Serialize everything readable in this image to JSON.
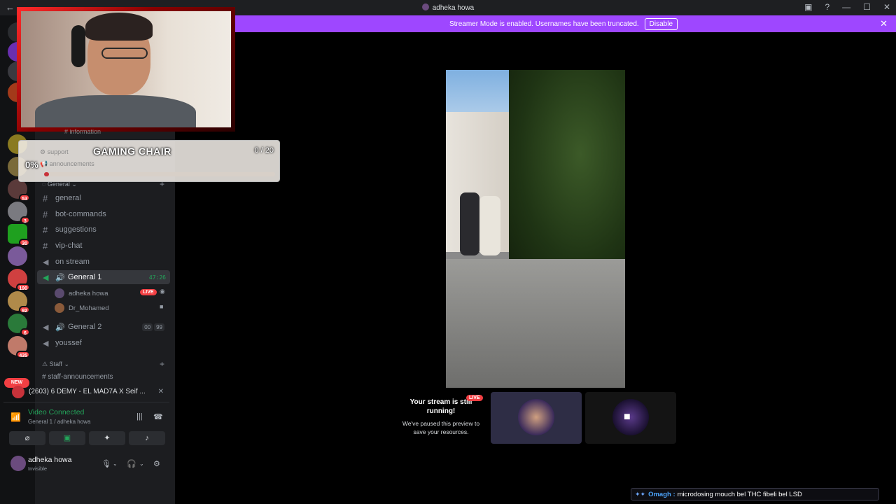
{
  "titlebar": {
    "title": "adheka howa"
  },
  "banner": {
    "text": "Streamer Mode is enabled. Usernames have been truncated.",
    "button": "Disable"
  },
  "guild_badges": [
    "53",
    "3",
    "30",
    "190",
    "92",
    "6",
    "435"
  ],
  "new_label": "NEW",
  "channels": {
    "ghost": [
      "information",
      "support",
      "announcements"
    ],
    "category_general": "General",
    "items": [
      {
        "label": "general",
        "type": "text"
      },
      {
        "label": "bot-commands",
        "type": "text"
      },
      {
        "label": "suggestions",
        "type": "text"
      },
      {
        "label": "vip-chat",
        "type": "text"
      },
      {
        "label": "on stream",
        "type": "announce"
      }
    ],
    "voice_active": {
      "label": "General 1",
      "timer": "47:26"
    },
    "voice_users": [
      {
        "name": "adheka howa",
        "live": "LIVE"
      },
      {
        "name": "Dr_Mohamed"
      }
    ],
    "voice_2": {
      "label": "General 2",
      "c1": "00",
      "c2": "99"
    },
    "after": "youssef",
    "category_staff": "Staff",
    "staff_ghost": "staff-announcements"
  },
  "activity": {
    "text": "(2603) 6 DEMY - EL MAD7A X Seif ..."
  },
  "voice": {
    "status": "Video Connected",
    "sub": "General 1 / adheka howa"
  },
  "user": {
    "name": "adheka howa",
    "status": "Invisible"
  },
  "goal": {
    "title": "GAMING CHAIR",
    "count": "0 / 20",
    "percent": "0%",
    "progress": 0.02
  },
  "notice": {
    "line1": "Your stream is still running!",
    "line2": "We've paused this preview to save your resources.",
    "live": "LIVE"
  },
  "chat": {
    "nick": "Omagh :",
    "message": "microdosing mouch bel THC fibeli bel LSD"
  },
  "colors": {
    "accent": "#9e47ff",
    "live": "#f23f43",
    "connected": "#23a55a"
  }
}
